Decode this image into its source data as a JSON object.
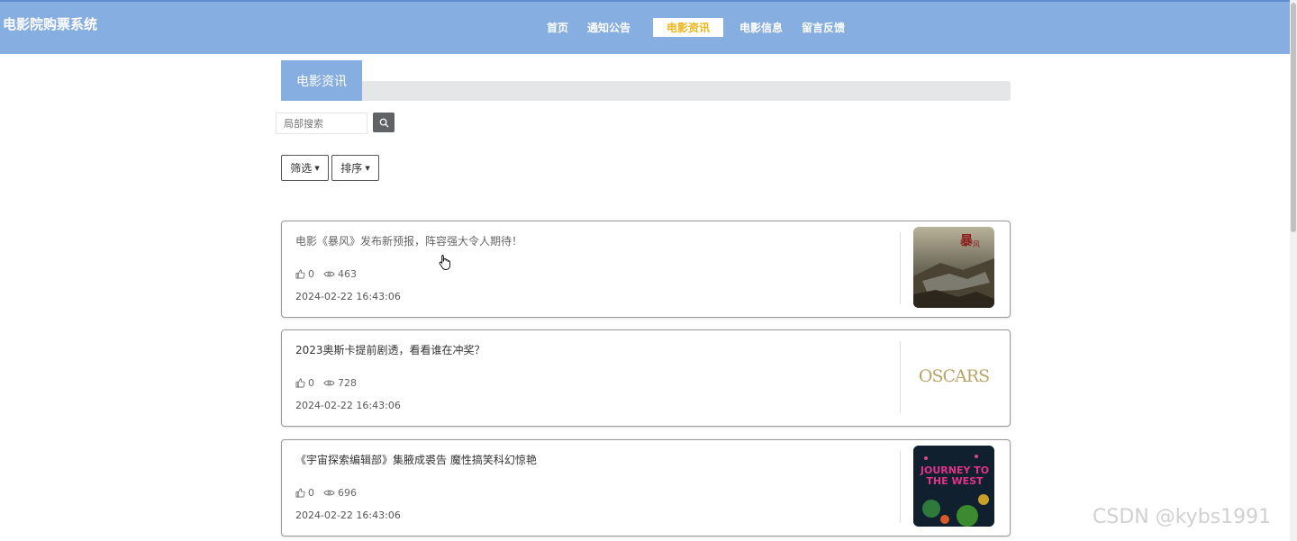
{
  "app": {
    "title": "电影院购票系统"
  },
  "nav": {
    "items": [
      {
        "label": "首页",
        "active": false
      },
      {
        "label": "通知公告",
        "active": false
      },
      {
        "label": "电影资讯",
        "active": true
      },
      {
        "label": "电影信息",
        "active": false
      },
      {
        "label": "留言反馈",
        "active": false
      }
    ]
  },
  "section": {
    "title": "电影资讯"
  },
  "search": {
    "placeholder": "局部搜索",
    "icon": "search-icon"
  },
  "filters": {
    "filter_label": "筛选",
    "sort_label": "排序"
  },
  "articles": [
    {
      "title": "电影《暴风》发布新预报，阵容强大令人期待！",
      "likes": "0",
      "views": "463",
      "date": "2024-02-22 16:43:06",
      "thumb": "poster-storm"
    },
    {
      "title": "2023奥斯卡提前剧透，看看谁在冲奖？",
      "likes": "0",
      "views": "728",
      "date": "2024-02-22 16:43:06",
      "thumb": "oscars-logo",
      "thumb_text": "OSCARS"
    },
    {
      "title": "《宇宙探索编辑部》集腋成裘告 魔性搞笑科幻惊艳",
      "likes": "0",
      "views": "696",
      "date": "2024-02-22 16:43:06",
      "thumb": "poster-journey",
      "thumb_text": "JOURNEY TO THE WEST"
    }
  ],
  "watermark": "CSDN @kybs1991",
  "colors": {
    "header": "#87aee0",
    "active_nav_text": "#f2b61b"
  }
}
